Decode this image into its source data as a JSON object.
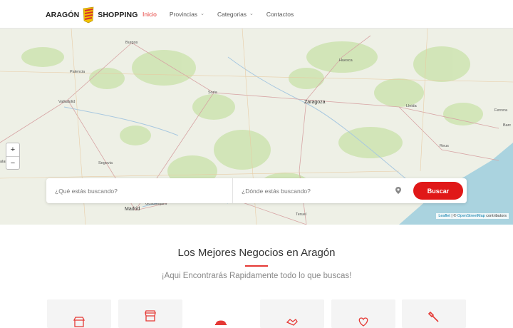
{
  "header": {
    "logo_left": "ARAGÓN",
    "logo_right": "SHOPPING",
    "nav": [
      {
        "label": "Inicio",
        "active": true,
        "dropdown": false
      },
      {
        "label": "Provincias",
        "active": false,
        "dropdown": true
      },
      {
        "label": "Categorias",
        "active": false,
        "dropdown": true
      },
      {
        "label": "Contactos",
        "active": false,
        "dropdown": false
      }
    ]
  },
  "map": {
    "cities": {
      "zaragoza": "Zaragoza",
      "huesca": "Huesca",
      "lleida": "Lleida",
      "burgos": "Burgos",
      "valladolid": "Valladolid",
      "palencia": "Palencia",
      "soria": "Soria",
      "segovia": "Segovia",
      "madrid": "Madrid",
      "teruel": "Teruel",
      "guadalajara": "Guadalajara",
      "reus": "Reus",
      "salamanca": "alamanca",
      "ferrera": "Ferrera",
      "barc": "Barc"
    },
    "zoom_in": "+",
    "zoom_out": "−",
    "attribution_leaflet": "Leaflet",
    "attribution_sep": " | © ",
    "attribution_osm": "OpenStreetMap",
    "attribution_rest": " contributors"
  },
  "search": {
    "what_placeholder": "¿Qué estás buscando?",
    "where_placeholder": "¿Dónde estás buscando?",
    "button_label": "Buscar"
  },
  "content": {
    "title": "Los Mejores Negocios en Aragón",
    "subtitle": "¡Aqui Encontrarás Rapidamente todo lo que buscas!"
  },
  "categories": [
    {
      "icon": "store-icon"
    },
    {
      "icon": "shop-icon"
    },
    {
      "icon": "food-icon"
    },
    {
      "icon": "handshake-icon"
    },
    {
      "icon": "health-icon"
    },
    {
      "icon": "tools-icon"
    }
  ],
  "colors": {
    "accent": "#e53935",
    "button": "#e01818",
    "sea": "#aad3df",
    "land": "#eef0e6",
    "forest": "#cfe4b4"
  }
}
